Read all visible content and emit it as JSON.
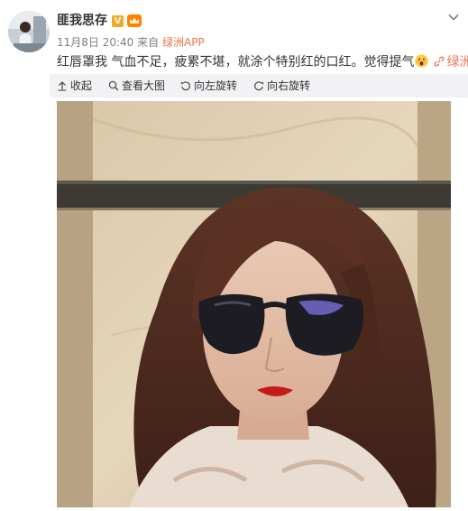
{
  "post": {
    "username": "匪我思存",
    "verified_badge": "V",
    "date": "11月8日 20:40",
    "source_prefix": "来自",
    "source_name": "绿洲APP",
    "text": "红唇罩我 气血不足，疲累不堪，就涂个特别红的口红。觉得提气",
    "link_label": "绿洲"
  },
  "toolbar": {
    "collapse_label": "收起",
    "view_large_label": "查看大图",
    "rotate_left_label": "向左旋转",
    "rotate_right_label": "向右旋转"
  },
  "icons": {
    "menu": "chevron-down-icon",
    "verified": "verified-v-icon",
    "member": "crown-icon",
    "emoji": "surprised-face-emoji-icon",
    "link": "link-icon",
    "collapse": "collapse-up-icon",
    "view": "magnifier-icon",
    "rotate_left": "rotate-left-icon",
    "rotate_right": "rotate-right-icon"
  },
  "colors": {
    "link": "#eb7350",
    "meta": "#808080",
    "toolbar_bg": "#f2f2f5",
    "verified": "#f5a623"
  }
}
